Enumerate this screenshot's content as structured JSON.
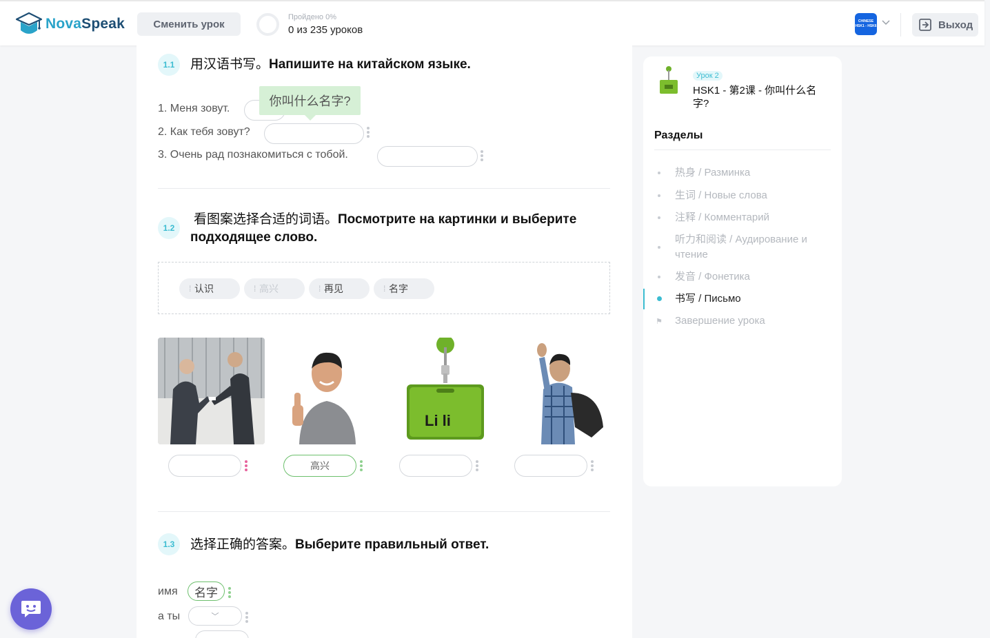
{
  "header": {
    "logo": {
      "nova": "Nova",
      "speak": "Speak"
    },
    "change_lesson": "Сменить урок",
    "progress_pct": "Пройдено 0%",
    "progress_count": "0 из 235 уроков",
    "lang_badge_line1": "CHINESE",
    "lang_badge_line2": "HSK1 - HSK6",
    "exit": "Выход"
  },
  "section1": {
    "num": "1.1",
    "title_cn": "用汉语书写。",
    "title_ru": "Напишите на китайском языке.",
    "tooltip": "你叫什么名字?",
    "questions": [
      "1. Меня зовут.",
      "2. Как тебя зовут?",
      "3. Очень рад познакомиться с тобой."
    ]
  },
  "section2": {
    "num": "1.2",
    "title_cn": "看图案选择合适的词语。",
    "title_ru": "Посмотрите на картинки и выберите подходящее слово.",
    "chips": [
      "认识",
      "高兴",
      "再见",
      "名字"
    ],
    "answers": [
      "",
      "高兴",
      "",
      ""
    ],
    "badge_text": "Li li"
  },
  "section3": {
    "num": "1.3",
    "title_cn": "选择正确的答案。",
    "title_ru": "Выберите правильный ответ.",
    "row1_label": "имя",
    "row1_word": "名字",
    "row2_label": "а ты",
    "dropdown_chevron": "﹀"
  },
  "sidebar": {
    "lesson_tag": "Урок 2",
    "lesson_title": "HSK1 - 第2课 - 你叫什么名字?",
    "sections_heading": "Разделы",
    "items": [
      "热身 / Разминка",
      "生词 / Новые слова",
      "注释 / Комментарий",
      "听力和阅读 / Аудирование и чтение",
      "发音 / Фонетика",
      "书写 / Письмо",
      "Завершение урока"
    ],
    "active_index": 5
  },
  "colors": {
    "accent": "#3bbcd1",
    "brand_dark": "#1d4e74",
    "correct_green": "#6cbf6c",
    "chat_purple": "#6b63d8"
  },
  "icons": [
    "graduation-cap-logo-icon",
    "chevron-down-icon",
    "exit-icon",
    "flag-icon",
    "chat-bot-icon",
    "drag-handle-icon"
  ]
}
